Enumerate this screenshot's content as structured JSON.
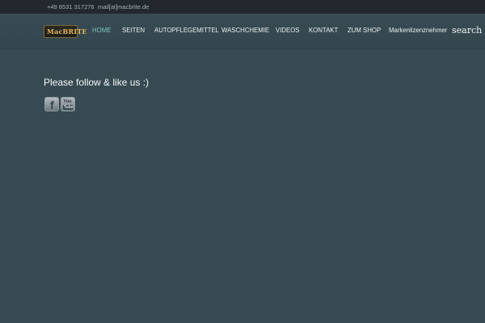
{
  "top_bar": {
    "phone": "+49 8531 317276",
    "email": "mail[at]macbrite.de"
  },
  "header": {
    "logo": {
      "text": "MacBRITE"
    },
    "nav": [
      {
        "label": "HOME",
        "active": true
      },
      {
        "label": "SEITEN",
        "active": false
      },
      {
        "label": "AUTOPFLEGEMITTEL",
        "active": false
      },
      {
        "label": "WASCHCHEMIE",
        "active": false
      },
      {
        "label": "VIDEOS",
        "active": false
      },
      {
        "label": "KONTAKT",
        "active": false
      },
      {
        "label": "ZUM SHOP",
        "active": false
      },
      {
        "label": "Markenlizenznehmer",
        "active": false
      }
    ],
    "search_label": "search"
  },
  "main": {
    "follow_text": "Please follow & like us :)",
    "social": [
      {
        "name": "facebook",
        "glyph": "f",
        "icon": "facebook-icon"
      },
      {
        "name": "youtube",
        "glyph_top": "You",
        "glyph_bottom": "Tube",
        "icon": "youtube-icon"
      }
    ]
  },
  "colors": {
    "background": "#374a52",
    "top_bar": "#22282d",
    "nav_active": "#77c6c0",
    "logo_gold": "#e2b65c"
  }
}
